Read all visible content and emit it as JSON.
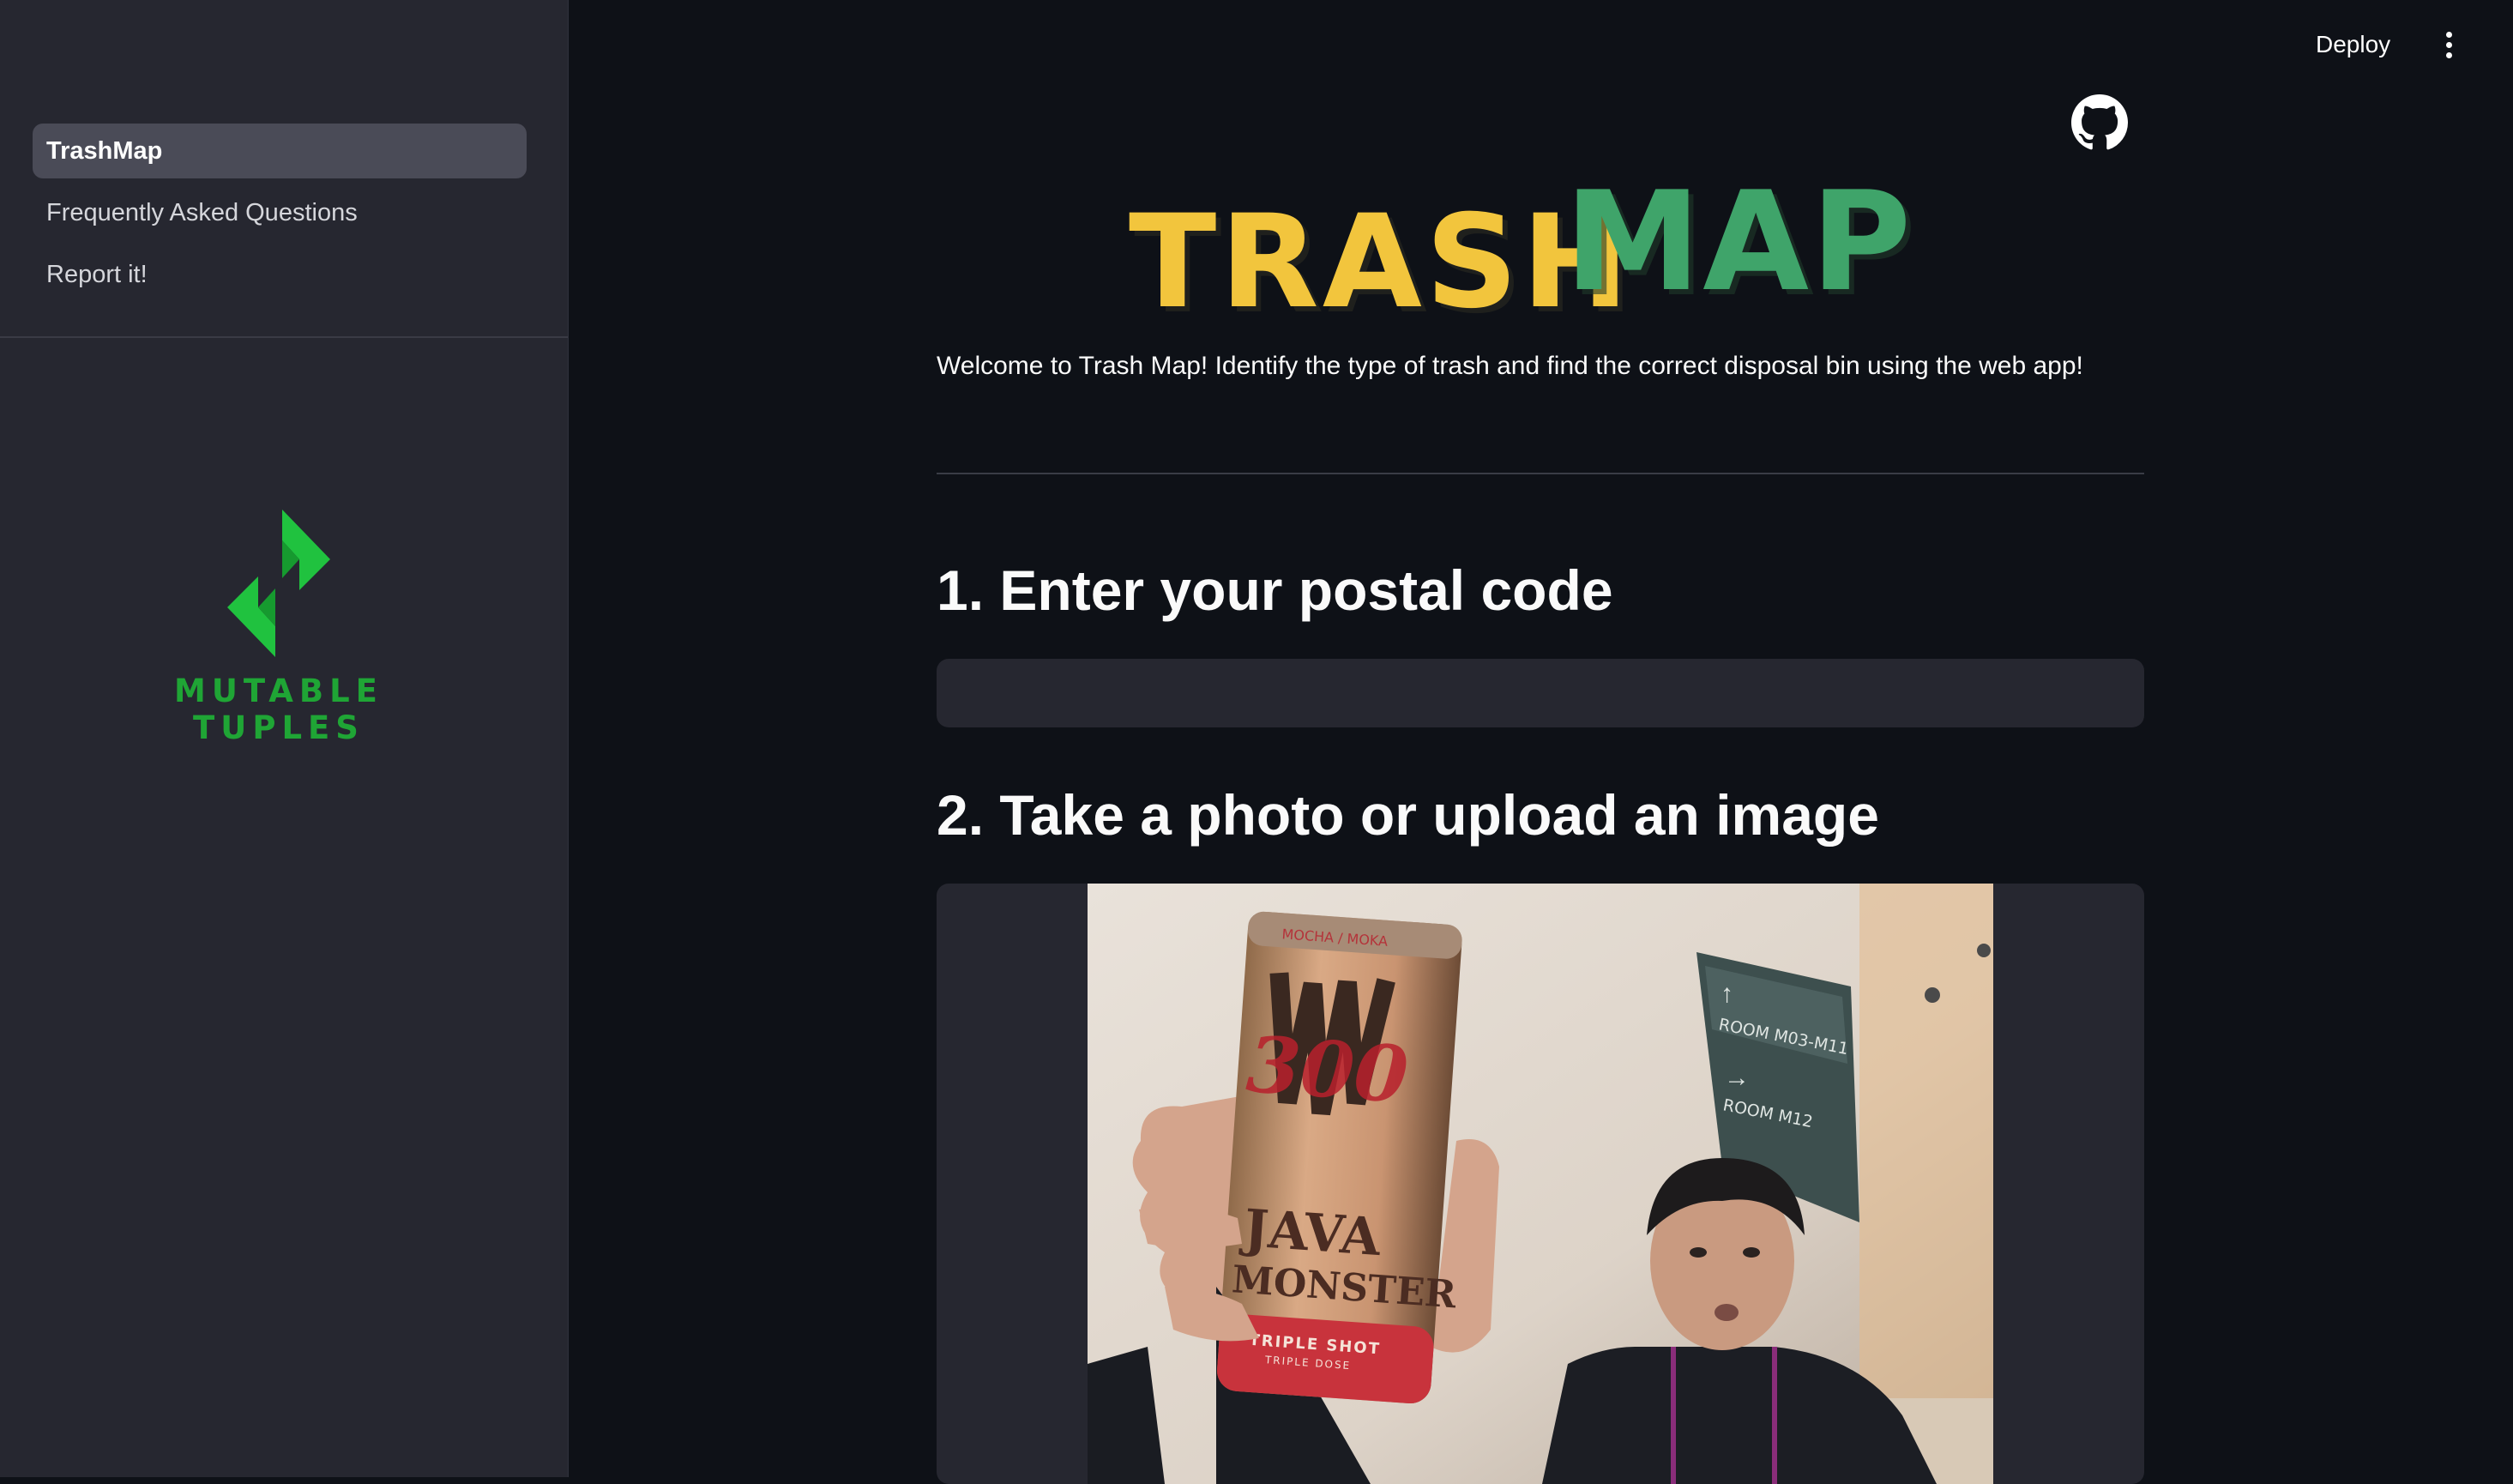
{
  "sidebar": {
    "nav_items": [
      {
        "label": "TrashMap",
        "active": true
      },
      {
        "label": "Frequently Asked Questions",
        "active": false
      },
      {
        "label": "Report it!",
        "active": false
      }
    ],
    "logo": {
      "text": "MUTABLE TUPLES",
      "color": "#1fa535"
    }
  },
  "header": {
    "deploy_label": "Deploy",
    "menu_icon": "kebab-menu-icon"
  },
  "main": {
    "title_logo": "TRASHMAP!",
    "github_icon": "github-icon",
    "welcome": "Welcome to Trash Map! Identify the type of trash and find the correct disposal bin using the web app!",
    "section1_heading": "1. Enter your postal code",
    "postal_code": {
      "value": "",
      "placeholder": ""
    },
    "section2_heading": "2. Take a photo or upload an image",
    "photo": {
      "can_line1": "JAVA",
      "can_line2": "MONSTER",
      "can_line3": "TRIPLE SHOT",
      "can_line4": "TRIPLE DOSE",
      "can_number": "300",
      "can_top": "MOCHA / MOKA",
      "sign_line1": "ROOM M03-M11",
      "sign_line2": "ROOM M12"
    }
  },
  "colors": {
    "background": "#0e1117",
    "sidebar": "#262730",
    "title_yellow": "#f2c53d",
    "title_green": "#3fa46a"
  }
}
